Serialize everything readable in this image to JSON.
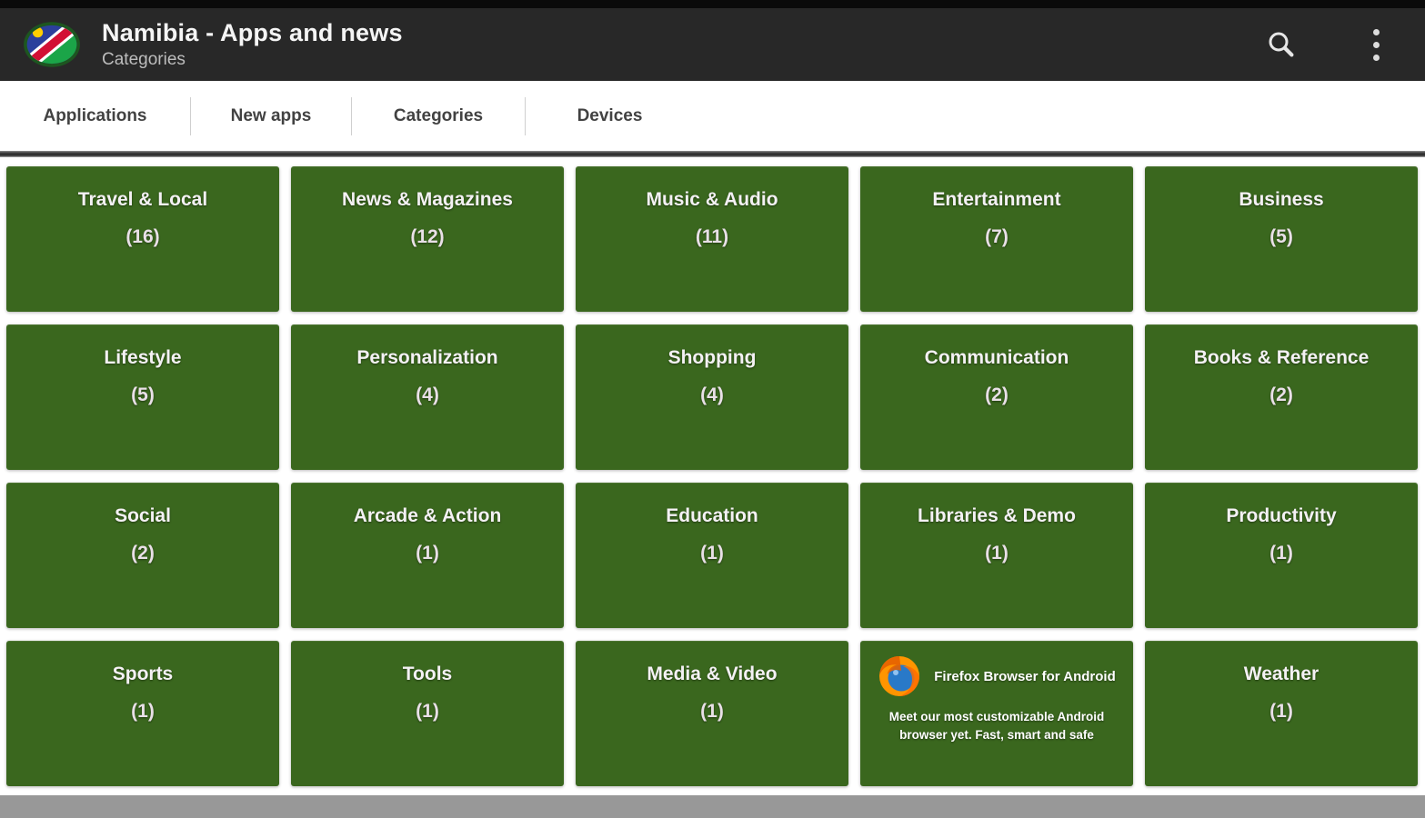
{
  "app_bar": {
    "title": "Namibia - Apps and news",
    "subtitle": "Categories",
    "logo_icon": "namibia-flag-logo",
    "search_icon": "search",
    "overflow_icon": "overflow-menu"
  },
  "tabs": [
    "Applications",
    "New apps",
    "Categories",
    "Devices"
  ],
  "tiles": [
    {
      "name": "Travel & Local",
      "count_label": "(16)"
    },
    {
      "name": "News & Magazines",
      "count_label": "(12)"
    },
    {
      "name": "Music & Audio",
      "count_label": "(11)"
    },
    {
      "name": "Entertainment",
      "count_label": "(7)"
    },
    {
      "name": "Business",
      "count_label": "(5)"
    },
    {
      "name": "Lifestyle",
      "count_label": "(5)"
    },
    {
      "name": "Personalization",
      "count_label": "(4)"
    },
    {
      "name": "Shopping",
      "count_label": "(4)"
    },
    {
      "name": "Communication",
      "count_label": "(2)"
    },
    {
      "name": "Books & Reference",
      "count_label": "(2)"
    },
    {
      "name": "Social",
      "count_label": "(2)"
    },
    {
      "name": "Arcade & Action",
      "count_label": "(1)"
    },
    {
      "name": "Education",
      "count_label": "(1)"
    },
    {
      "name": "Libraries & Demo",
      "count_label": "(1)"
    },
    {
      "name": "Productivity",
      "count_label": "(1)"
    },
    {
      "name": "Sports",
      "count_label": "(1)"
    },
    {
      "name": "Tools",
      "count_label": "(1)"
    },
    {
      "name": "Media & Video",
      "count_label": "(1)"
    },
    {
      "name": "Weather",
      "count_label": "(1)"
    }
  ],
  "ad_tile": {
    "title": "Firefox Browser for Android",
    "description_line1": "Meet our most customizable Android",
    "description_line2": "browser yet. Fast, smart and safe",
    "logo_icon": "firefox-logo"
  },
  "colors": {
    "tile_green": "#3a671e",
    "app_bar_bg": "#282828",
    "bottom_bar_gray": "#989898"
  }
}
